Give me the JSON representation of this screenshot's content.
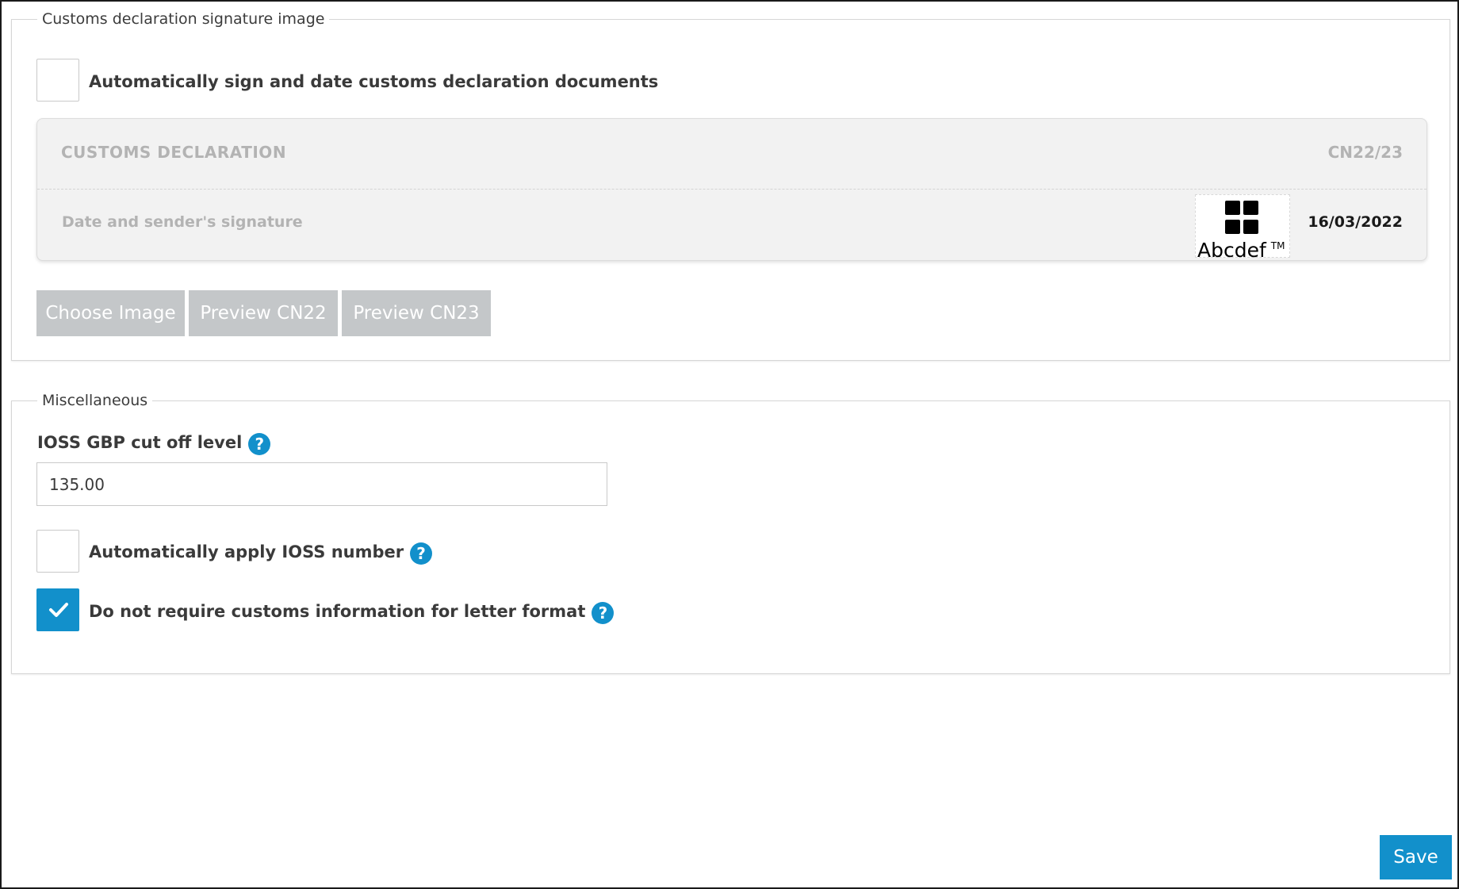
{
  "signature_section": {
    "legend": "Customs declaration signature image",
    "auto_sign_label": "Automatically sign and date customs declaration documents",
    "auto_sign_checked": false,
    "preview": {
      "title": "CUSTOMS DECLARATION",
      "form_code": "CN22/23",
      "signature_row_label": "Date and sender's signature",
      "signature_text": "Abcdef",
      "signature_trademark": "TM",
      "date": "16/03/2022"
    },
    "buttons": {
      "choose_image": "Choose Image",
      "preview_cn22": "Preview CN22",
      "preview_cn23": "Preview CN23"
    }
  },
  "misc_section": {
    "legend": "Miscellaneous",
    "ioss_cutoff_label": "IOSS GBP cut off level",
    "ioss_cutoff_value": "135.00",
    "auto_ioss_label": "Automatically apply IOSS number",
    "auto_ioss_checked": false,
    "no_customs_letter_label": "Do not require customs information for letter format",
    "no_customs_letter_checked": true,
    "help_glyph": "?"
  },
  "footer": {
    "save_label": "Save"
  },
  "colors": {
    "accent": "#1290cb",
    "disabled_button": "#c4c7c9",
    "card_background": "#f2f2f2"
  },
  "icons": [
    "checkmark-icon",
    "help-icon",
    "signature-logo-icon"
  ]
}
